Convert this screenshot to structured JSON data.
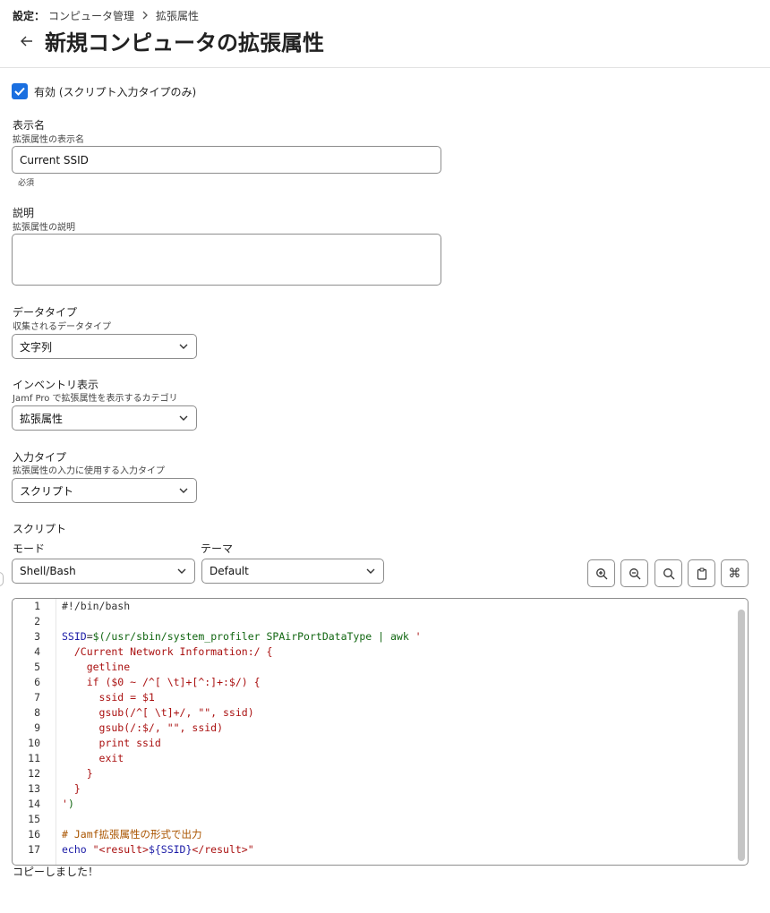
{
  "breadcrumb": {
    "root": "設定：",
    "parent": "コンピュータ管理",
    "current": "拡張属性"
  },
  "page": {
    "title": "新規コンピュータの拡張属性"
  },
  "enabled": {
    "label": "有効 (スクリプト入力タイプのみ)",
    "checked": true
  },
  "display_name": {
    "label": "表示名",
    "help": "拡張属性の表示名",
    "value": "Current SSID",
    "required": "必須"
  },
  "description": {
    "label": "説明",
    "help": "拡張属性の説明",
    "value": ""
  },
  "data_type": {
    "label": "データタイプ",
    "help": "収集されるデータタイプ",
    "selected": "文字列"
  },
  "inventory_display": {
    "label": "インベントリ表示",
    "help": "Jamf Pro で拡張属性を表示するカテゴリ",
    "selected": "拡張属性"
  },
  "input_type": {
    "label": "入力タイプ",
    "help": "拡張属性の入力に使用する入力タイプ",
    "selected": "スクリプト"
  },
  "script": {
    "label": "スクリプト",
    "mode_label": "モード",
    "mode_selected": "Shell/Bash",
    "theme_label": "テーマ",
    "theme_selected": "Default",
    "lines": [
      {
        "n": "1",
        "segs": [
          {
            "t": "#!/bin/bash",
            "c": "c-plain"
          }
        ]
      },
      {
        "n": "2",
        "segs": []
      },
      {
        "n": "3",
        "segs": [
          {
            "t": "SSID",
            "c": "c-var"
          },
          {
            "t": "=",
            "c": "c-plain"
          },
          {
            "t": "$(/usr/sbin/system_profiler SPAirPortDataType | awk ",
            "c": "c-green"
          },
          {
            "t": "'",
            "c": "c-str"
          }
        ]
      },
      {
        "n": "4",
        "segs": [
          {
            "t": "  /Current Network Information:/ {",
            "c": "c-str"
          }
        ]
      },
      {
        "n": "5",
        "segs": [
          {
            "t": "    getline",
            "c": "c-str"
          }
        ]
      },
      {
        "n": "6",
        "segs": [
          {
            "t": "    if ($0 ~ /^[ \\t]+[^:]+:$/) {",
            "c": "c-str"
          }
        ]
      },
      {
        "n": "7",
        "segs": [
          {
            "t": "      ssid = $1",
            "c": "c-str"
          }
        ]
      },
      {
        "n": "8",
        "segs": [
          {
            "t": "      gsub(/^[ \\t]+/, \"\", ssid)",
            "c": "c-str"
          }
        ]
      },
      {
        "n": "9",
        "segs": [
          {
            "t": "      gsub(/:$/, \"\", ssid)",
            "c": "c-str"
          }
        ]
      },
      {
        "n": "10",
        "segs": [
          {
            "t": "      print ssid",
            "c": "c-str"
          }
        ]
      },
      {
        "n": "11",
        "segs": [
          {
            "t": "      exit",
            "c": "c-str"
          }
        ]
      },
      {
        "n": "12",
        "segs": [
          {
            "t": "    }",
            "c": "c-str"
          }
        ]
      },
      {
        "n": "13",
        "segs": [
          {
            "t": "  }",
            "c": "c-str"
          }
        ]
      },
      {
        "n": "14",
        "segs": [
          {
            "t": "'",
            "c": "c-str"
          },
          {
            "t": ")",
            "c": "c-green"
          }
        ]
      },
      {
        "n": "15",
        "segs": []
      },
      {
        "n": "16",
        "segs": [
          {
            "t": "# Jamf拡張属性の形式で出力",
            "c": "c-comment"
          }
        ]
      },
      {
        "n": "17",
        "segs": [
          {
            "t": "echo ",
            "c": "c-var"
          },
          {
            "t": "\"<result>",
            "c": "c-str"
          },
          {
            "t": "${SSID}",
            "c": "c-var"
          },
          {
            "t": "</result>\"",
            "c": "c-str"
          }
        ]
      }
    ]
  },
  "toolbar": {
    "icons": [
      "zoom-in-icon",
      "zoom-out-icon",
      "search-icon",
      "clipboard-icon",
      "command-icon"
    ]
  },
  "status": {
    "copied": "コピーしました！"
  },
  "colors": {
    "accent": "#1a6fe0"
  }
}
